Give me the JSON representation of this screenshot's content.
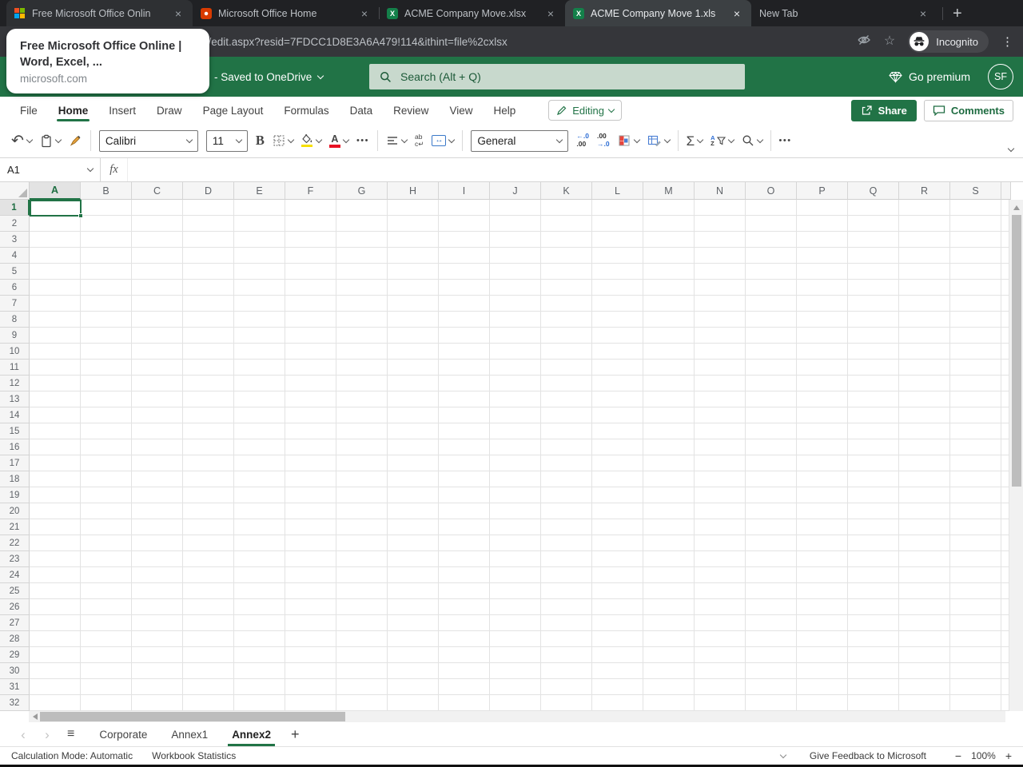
{
  "browser": {
    "tabs": [
      {
        "label": "Free Microsoft Office Onlin",
        "icon": "microsoft-logo",
        "active": false,
        "hover": true
      },
      {
        "label": "Microsoft Office Home",
        "icon": "office-logo",
        "active": false,
        "hover": false
      },
      {
        "label": "ACME Company Move.xlsx",
        "icon": "excel-logo",
        "active": false,
        "hover": false
      },
      {
        "label": "ACME Company Move 1.xls",
        "icon": "excel-logo",
        "active": true,
        "hover": false
      },
      {
        "label": "New Tab",
        "icon": "",
        "active": false,
        "hover": false
      }
    ],
    "url": "n/edit.aspx?resid=7FDCC1D8E3A6A479!114&ithint=file%2cxlsx",
    "incognito_label": "Incognito",
    "tooltip": {
      "title": "Free Microsoft Office Online | Word, Excel, ...",
      "domain": "microsoft.com"
    }
  },
  "header": {
    "saved_status": "- Saved to OneDrive",
    "search_placeholder": "Search (Alt + Q)",
    "go_premium_label": "Go premium",
    "avatar_initials": "SF"
  },
  "ribbon": {
    "tabs": [
      "File",
      "Home",
      "Insert",
      "Draw",
      "Page Layout",
      "Formulas",
      "Data",
      "Review",
      "View",
      "Help"
    ],
    "active_tab": "Home",
    "editing_label": "Editing",
    "share_label": "Share",
    "comments_label": "Comments"
  },
  "toolbar": {
    "font_name": "Calibri",
    "font_size": "11",
    "number_format": "General"
  },
  "formula_bar": {
    "name_box": "A1",
    "fx_label": "fx",
    "formula_value": ""
  },
  "grid": {
    "columns": [
      "A",
      "B",
      "C",
      "D",
      "E",
      "F",
      "G",
      "H",
      "I",
      "J",
      "K",
      "L",
      "M",
      "N",
      "O",
      "P",
      "Q",
      "R",
      "S"
    ],
    "row_count": 32,
    "selected_cell": "A1",
    "selected_column": "A",
    "selected_row": 1
  },
  "sheets": {
    "list": [
      {
        "name": "Corporate",
        "active": false
      },
      {
        "name": "Annex1",
        "active": false
      },
      {
        "name": "Annex2",
        "active": true
      }
    ]
  },
  "status_bar": {
    "calculation_mode": "Calculation Mode: Automatic",
    "workbook_statistics": "Workbook Statistics",
    "feedback": "Give Feedback to Microsoft",
    "zoom_level": "100%"
  },
  "icons": {
    "close_tab": "×",
    "new_tab": "+",
    "browser_menu": "⋮",
    "star": "☆",
    "undo": "↶",
    "bold": "B",
    "font_color": "A",
    "more": "•••",
    "sum": "Σ",
    "sort_a": "A",
    "sort_z": "Z",
    "wrap_top": "ab",
    "wrap_bottom": "c↵",
    "merge_arrows": "↔",
    "decrease_decimal_top": "←.0",
    "decrease_decimal_bottom": ".00",
    "increase_decimal_top": ".00",
    "increase_decimal_bottom": "→.0",
    "prev_sheet": "‹",
    "next_sheet": "›",
    "sheet_menu": "≡",
    "add_sheet": "+",
    "minus": "−",
    "plus": "+"
  },
  "colors": {
    "excel_green": "#217346",
    "chrome_dark": "#202124",
    "search_box_bg": "#c8d9cd",
    "fill_yellow": "#f7e000",
    "font_color_red": "#e81123"
  }
}
